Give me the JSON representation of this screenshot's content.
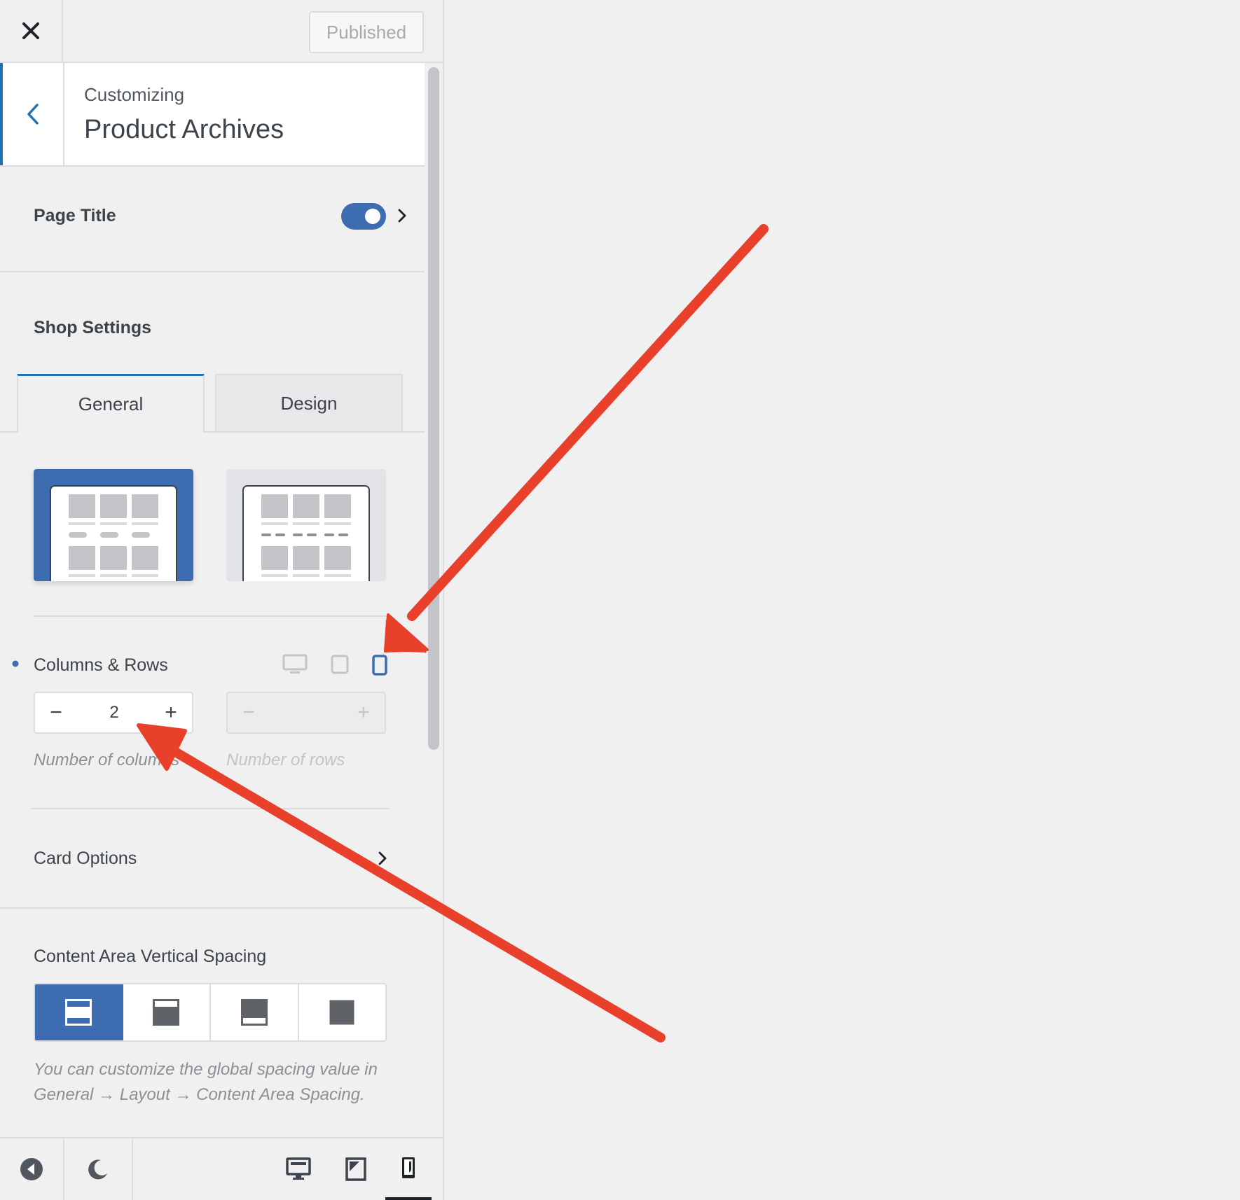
{
  "topbar": {
    "close_label": "Close",
    "publish_label": "Published"
  },
  "header": {
    "customizing_label": "Customizing",
    "title": "Product Archives"
  },
  "page_title": {
    "label": "Page Title",
    "enabled": true
  },
  "shop_settings": {
    "heading": "Shop Settings",
    "tabs": [
      {
        "label": "General",
        "active": true
      },
      {
        "label": "Design",
        "active": false
      }
    ],
    "layouts": [
      {
        "name": "grid-layout-1",
        "active": true
      },
      {
        "name": "grid-layout-2",
        "active": false
      }
    ]
  },
  "columns_rows": {
    "label": "Columns & Rows",
    "active_device": "mobile",
    "columns": {
      "value": "2",
      "help": "Number of columns"
    },
    "rows": {
      "value": "",
      "help": "Number of rows"
    }
  },
  "card_options": {
    "label": "Card Options"
  },
  "content_spacing": {
    "label": "Content Area Vertical Spacing",
    "options": [
      "top-and-bottom",
      "only-top",
      "only-bottom",
      "disabled"
    ],
    "active_index": 0,
    "help": "You can customize the global spacing value in General → Layout → Content Area Spacing."
  },
  "footer": {
    "active_device": "mobile"
  },
  "colors": {
    "accent": "#3d6cb0",
    "annotation": "#e8402a"
  }
}
